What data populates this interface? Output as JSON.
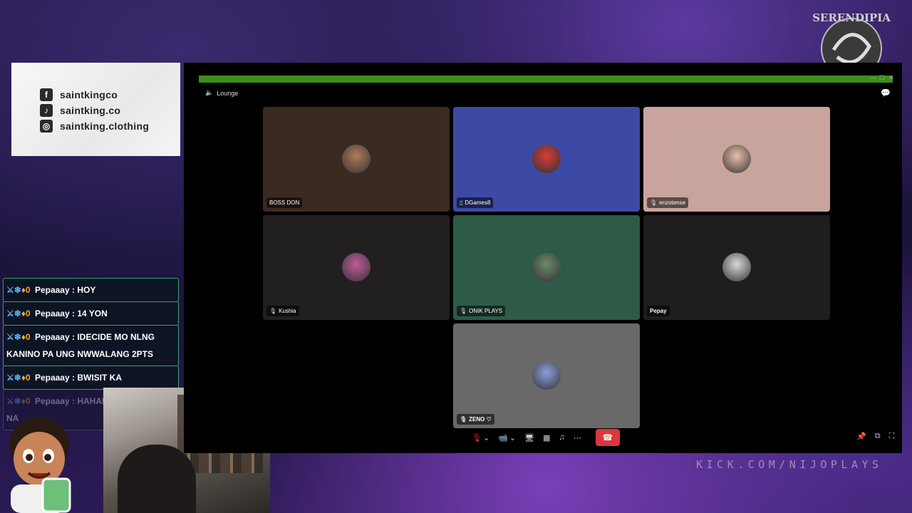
{
  "social": {
    "facebook": "saintkingco",
    "tiktok": "saintking.co",
    "instagram": "saintking.clothing"
  },
  "chat": [
    {
      "user": "Pepaaay",
      "text": ": HOY"
    },
    {
      "user": "Pepaaay",
      "text": ": 14 YON"
    },
    {
      "user": "Pepaaay",
      "text": ": IDECIDE MO NLNG KANINO PA UNG NWWALANG 2PTS"
    },
    {
      "user": "Pepaaay",
      "text": ": BWISIT KA"
    },
    {
      "user": "Pepaaay",
      "text": ": HAHAHA DALIAN MO NA"
    }
  ],
  "discord": {
    "channel": "Lounge",
    "participants": [
      {
        "name": "BOSS DON",
        "bg": "#3b2a22",
        "avatar": "#b07a5a",
        "muted": false
      },
      {
        "name": "DGames8",
        "bg": "#3c4aa6",
        "avatar": "#d83a3a",
        "muted": false,
        "prefix": "📱"
      },
      {
        "name": "enzotense",
        "bg": "#c9a49c",
        "avatar": "#e8c0a8",
        "muted": true
      },
      {
        "name": "Kushia",
        "bg": "#221f20",
        "avatar": "#c05a9a",
        "muted": true
      },
      {
        "name": "ONIK PLAYS",
        "bg": "#2e5a48",
        "avatar": "#6b8a6a",
        "muted": true
      },
      {
        "name": "Pepay",
        "bg": "#1f1d1e",
        "avatar": "#d8d8d8",
        "muted": false
      },
      {
        "name": "ZENO ♡",
        "bg": "#6a6869",
        "avatar": "#8aa0d8",
        "muted": true
      }
    ]
  },
  "kick_url": "KICK.COM/NIJOPLAYS",
  "logo_text": "SERENDIPIA"
}
